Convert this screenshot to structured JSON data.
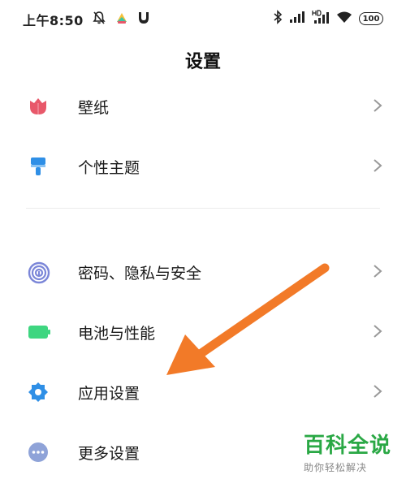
{
  "status_bar": {
    "time": "上午8:50",
    "battery": "100",
    "left_icons": [
      "alarm-off-icon",
      "colorful-app-icon",
      "shield-icon"
    ],
    "right_icons": [
      "bluetooth-icon",
      "signal-icon",
      "hd-signal-icon",
      "wifi-icon"
    ]
  },
  "page": {
    "title": "设置"
  },
  "items": [
    {
      "label": "壁纸",
      "icon": "tulip-icon",
      "color": "#e8586a"
    },
    {
      "label": "个性主题",
      "icon": "brush-icon",
      "color": "#2f8fe6"
    },
    {
      "label": "密码、隐私与安全",
      "icon": "fingerprint-icon",
      "color": "#7b86d8"
    },
    {
      "label": "电池与性能",
      "icon": "battery-icon",
      "color": "#3ed680"
    },
    {
      "label": "应用设置",
      "icon": "gear-icon",
      "color": "#2f8fe6"
    },
    {
      "label": "更多设置",
      "icon": "more-dots-icon",
      "color": "#8fa3d8"
    }
  ],
  "annotation": {
    "arrow_color": "#f27a28"
  },
  "watermark": {
    "title": "百科全说",
    "subtitle": "助你轻松解决"
  }
}
